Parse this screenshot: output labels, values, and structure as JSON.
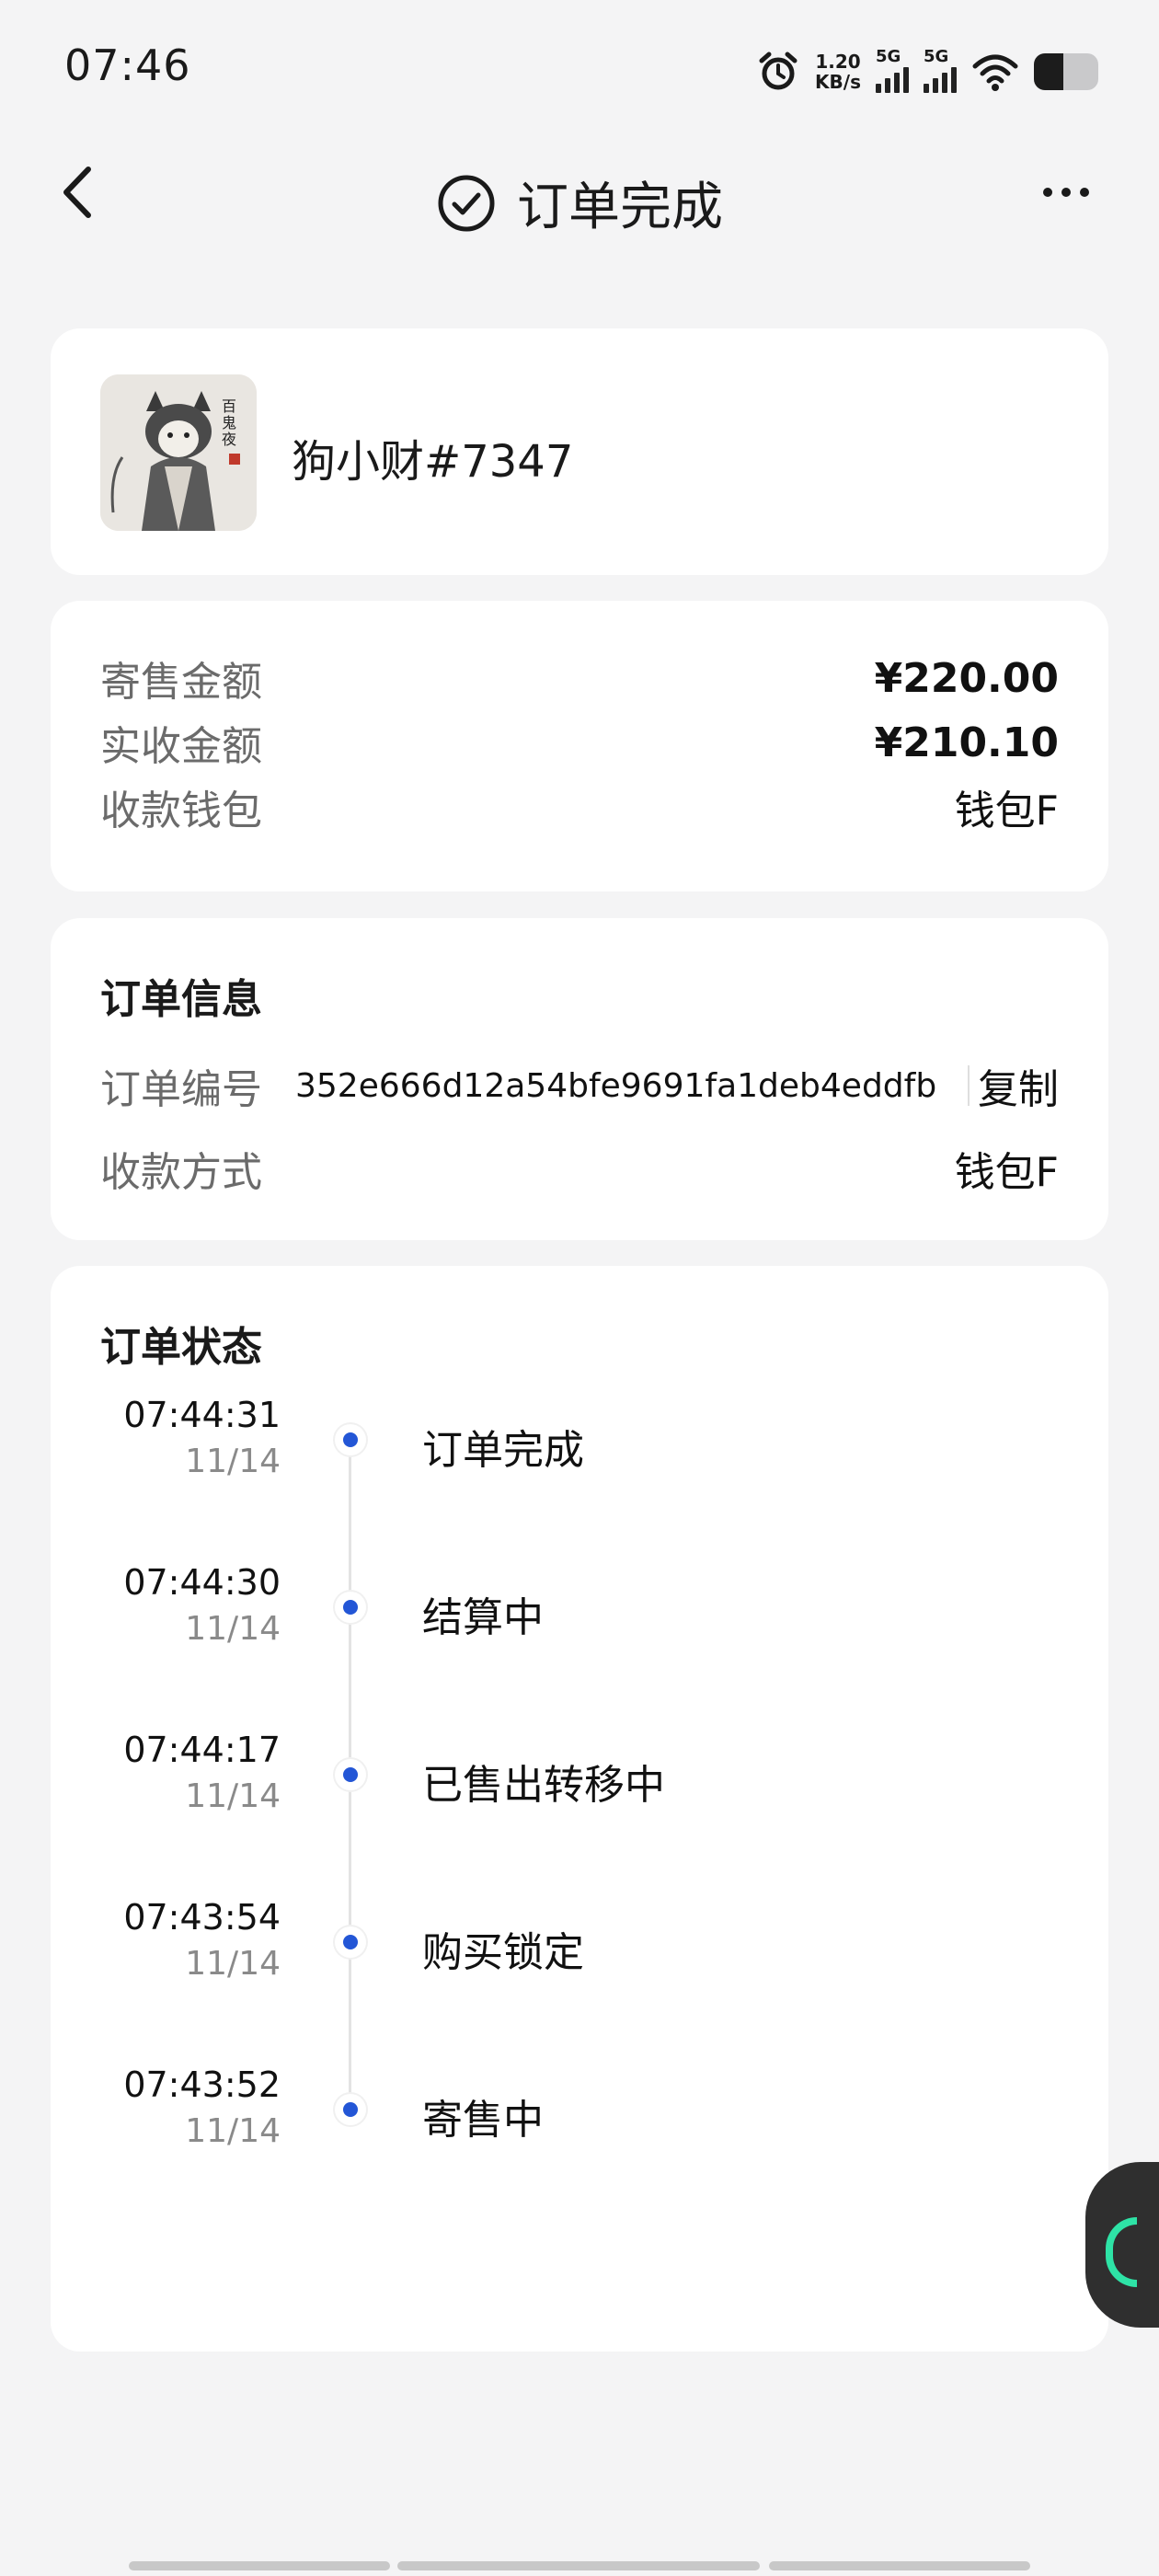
{
  "status_bar": {
    "time": "07:46",
    "speed_value": "1.20",
    "speed_unit": "KB/s",
    "net1": "5G",
    "net2": "5G"
  },
  "header": {
    "title": "订单完成"
  },
  "nft": {
    "name": "狗小财#7347"
  },
  "amounts": {
    "consign_label": "寄售金额",
    "consign_value": "¥220.00",
    "received_label": "实收金额",
    "received_value": "¥210.10",
    "wallet_label": "收款钱包",
    "wallet_value": "钱包F"
  },
  "order_info": {
    "title": "订单信息",
    "id_label": "订单编号",
    "id_value": "352e666d12a54bfe9691fa1deb4eddfb",
    "copy_label": "复制",
    "method_label": "收款方式",
    "method_value": "钱包F"
  },
  "order_status": {
    "title": "订单状态",
    "steps": [
      {
        "time": "07:44:31",
        "date": "11/14",
        "text": "订单完成"
      },
      {
        "time": "07:44:30",
        "date": "11/14",
        "text": "结算中"
      },
      {
        "time": "07:44:17",
        "date": "11/14",
        "text": "已售出转移中"
      },
      {
        "time": "07:43:54",
        "date": "11/14",
        "text": "购买锁定"
      },
      {
        "time": "07:43:52",
        "date": "11/14",
        "text": "寄售中"
      }
    ]
  },
  "colors": {
    "accent": "#2356d6",
    "background": "#f4f4f5",
    "float_accent": "#2ee3a6"
  },
  "icons": {
    "back": "chevron-left-icon",
    "title": "check-circle-icon",
    "more": "more-dots-icon",
    "alarm": "alarm-icon",
    "wifi": "wifi-icon",
    "battery": "battery-icon"
  }
}
